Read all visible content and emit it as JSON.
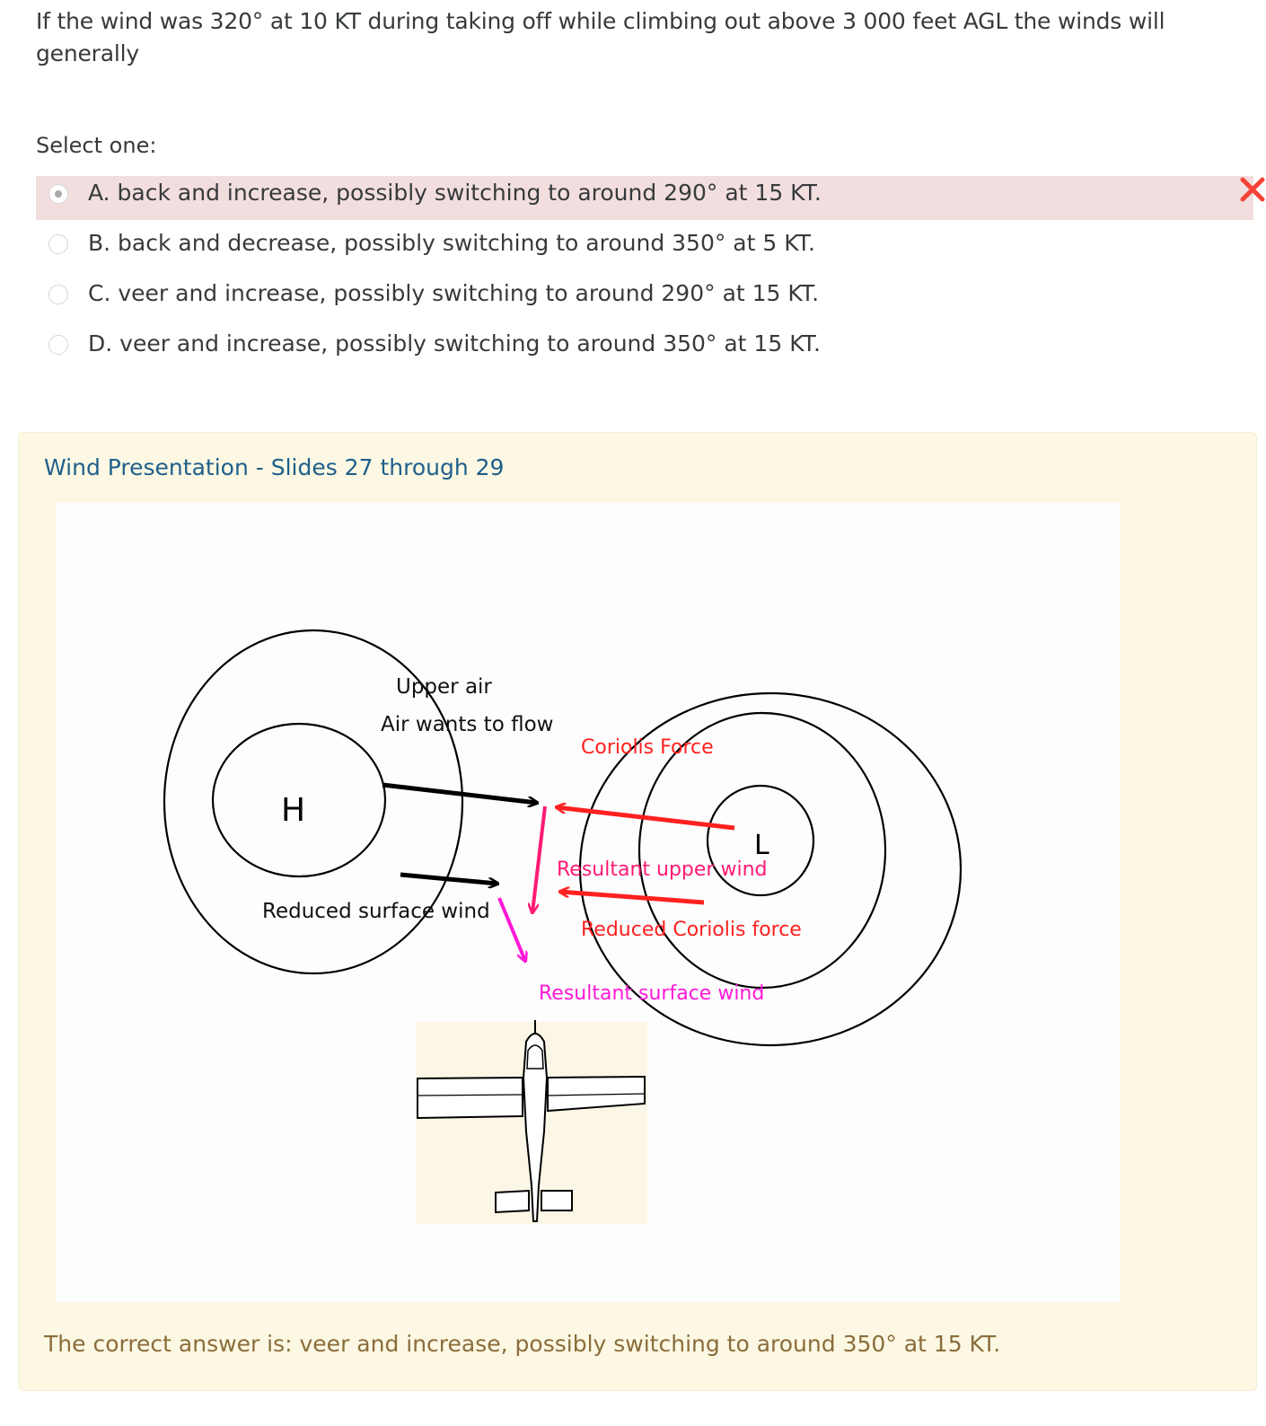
{
  "question": {
    "text": "If the wind was 320° at 10 KT during taking off while climbing out above 3 000 feet AGL the winds will generally"
  },
  "prompt": "Select one:",
  "answers": [
    {
      "label": "A. back and increase, possibly switching to around 290° at 15 KT.",
      "selected": true,
      "state": "incorrect"
    },
    {
      "label": "B. back and decrease, possibly switching to around 350° at 5 KT.",
      "selected": false
    },
    {
      "label": "C. veer and increase, possibly switching to around 290° at 15 KT.",
      "selected": false
    },
    {
      "label": "D. veer and increase, possibly switching to around 350° at 15 KT.",
      "selected": false
    }
  ],
  "feedback": {
    "link_text": "Wind Presentation - Slides 27 through 29",
    "correct_answer": "The correct answer is: veer and increase, possibly switching to around 350° at 15 KT."
  },
  "diagram": {
    "high_label": "H",
    "low_label": "L",
    "upper_air": "Upper air",
    "air_wants_to_flow": "Air wants to flow",
    "coriolis_force": "Coriolis Force",
    "resultant_upper_wind": "Resultant upper wind",
    "reduced_surface_wind": "Reduced surface wind",
    "reduced_coriolis_force": "Reduced Coriolis force",
    "resultant_surface_wind": "Resultant surface wind"
  },
  "colors": {
    "incorrect_bg": "#f2dede",
    "incorrect_icon": "#f44336",
    "feedback_bg": "#fcf8e3",
    "link": "#1f5f8b",
    "correct_text": "#8a6d3b",
    "coriolis_red": "#ff2020",
    "resultant_upper_pink": "#ff1a75",
    "resultant_surface_magenta": "#ff19d8"
  }
}
